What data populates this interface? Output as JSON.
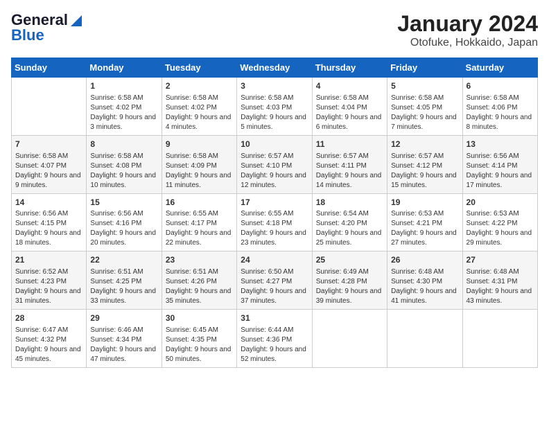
{
  "logo": {
    "line1": "General",
    "line2": "Blue"
  },
  "title": "January 2024",
  "subtitle": "Otofuke, Hokkaido, Japan",
  "days_of_week": [
    "Sunday",
    "Monday",
    "Tuesday",
    "Wednesday",
    "Thursday",
    "Friday",
    "Saturday"
  ],
  "weeks": [
    [
      {
        "day": "",
        "sunrise": "",
        "sunset": "",
        "daylight": ""
      },
      {
        "day": "1",
        "sunrise": "Sunrise: 6:58 AM",
        "sunset": "Sunset: 4:02 PM",
        "daylight": "Daylight: 9 hours and 3 minutes."
      },
      {
        "day": "2",
        "sunrise": "Sunrise: 6:58 AM",
        "sunset": "Sunset: 4:02 PM",
        "daylight": "Daylight: 9 hours and 4 minutes."
      },
      {
        "day": "3",
        "sunrise": "Sunrise: 6:58 AM",
        "sunset": "Sunset: 4:03 PM",
        "daylight": "Daylight: 9 hours and 5 minutes."
      },
      {
        "day": "4",
        "sunrise": "Sunrise: 6:58 AM",
        "sunset": "Sunset: 4:04 PM",
        "daylight": "Daylight: 9 hours and 6 minutes."
      },
      {
        "day": "5",
        "sunrise": "Sunrise: 6:58 AM",
        "sunset": "Sunset: 4:05 PM",
        "daylight": "Daylight: 9 hours and 7 minutes."
      },
      {
        "day": "6",
        "sunrise": "Sunrise: 6:58 AM",
        "sunset": "Sunset: 4:06 PM",
        "daylight": "Daylight: 9 hours and 8 minutes."
      }
    ],
    [
      {
        "day": "7",
        "sunrise": "Sunrise: 6:58 AM",
        "sunset": "Sunset: 4:07 PM",
        "daylight": "Daylight: 9 hours and 9 minutes."
      },
      {
        "day": "8",
        "sunrise": "Sunrise: 6:58 AM",
        "sunset": "Sunset: 4:08 PM",
        "daylight": "Daylight: 9 hours and 10 minutes."
      },
      {
        "day": "9",
        "sunrise": "Sunrise: 6:58 AM",
        "sunset": "Sunset: 4:09 PM",
        "daylight": "Daylight: 9 hours and 11 minutes."
      },
      {
        "day": "10",
        "sunrise": "Sunrise: 6:57 AM",
        "sunset": "Sunset: 4:10 PM",
        "daylight": "Daylight: 9 hours and 12 minutes."
      },
      {
        "day": "11",
        "sunrise": "Sunrise: 6:57 AM",
        "sunset": "Sunset: 4:11 PM",
        "daylight": "Daylight: 9 hours and 14 minutes."
      },
      {
        "day": "12",
        "sunrise": "Sunrise: 6:57 AM",
        "sunset": "Sunset: 4:12 PM",
        "daylight": "Daylight: 9 hours and 15 minutes."
      },
      {
        "day": "13",
        "sunrise": "Sunrise: 6:56 AM",
        "sunset": "Sunset: 4:14 PM",
        "daylight": "Daylight: 9 hours and 17 minutes."
      }
    ],
    [
      {
        "day": "14",
        "sunrise": "Sunrise: 6:56 AM",
        "sunset": "Sunset: 4:15 PM",
        "daylight": "Daylight: 9 hours and 18 minutes."
      },
      {
        "day": "15",
        "sunrise": "Sunrise: 6:56 AM",
        "sunset": "Sunset: 4:16 PM",
        "daylight": "Daylight: 9 hours and 20 minutes."
      },
      {
        "day": "16",
        "sunrise": "Sunrise: 6:55 AM",
        "sunset": "Sunset: 4:17 PM",
        "daylight": "Daylight: 9 hours and 22 minutes."
      },
      {
        "day": "17",
        "sunrise": "Sunrise: 6:55 AM",
        "sunset": "Sunset: 4:18 PM",
        "daylight": "Daylight: 9 hours and 23 minutes."
      },
      {
        "day": "18",
        "sunrise": "Sunrise: 6:54 AM",
        "sunset": "Sunset: 4:20 PM",
        "daylight": "Daylight: 9 hours and 25 minutes."
      },
      {
        "day": "19",
        "sunrise": "Sunrise: 6:53 AM",
        "sunset": "Sunset: 4:21 PM",
        "daylight": "Daylight: 9 hours and 27 minutes."
      },
      {
        "day": "20",
        "sunrise": "Sunrise: 6:53 AM",
        "sunset": "Sunset: 4:22 PM",
        "daylight": "Daylight: 9 hours and 29 minutes."
      }
    ],
    [
      {
        "day": "21",
        "sunrise": "Sunrise: 6:52 AM",
        "sunset": "Sunset: 4:23 PM",
        "daylight": "Daylight: 9 hours and 31 minutes."
      },
      {
        "day": "22",
        "sunrise": "Sunrise: 6:51 AM",
        "sunset": "Sunset: 4:25 PM",
        "daylight": "Daylight: 9 hours and 33 minutes."
      },
      {
        "day": "23",
        "sunrise": "Sunrise: 6:51 AM",
        "sunset": "Sunset: 4:26 PM",
        "daylight": "Daylight: 9 hours and 35 minutes."
      },
      {
        "day": "24",
        "sunrise": "Sunrise: 6:50 AM",
        "sunset": "Sunset: 4:27 PM",
        "daylight": "Daylight: 9 hours and 37 minutes."
      },
      {
        "day": "25",
        "sunrise": "Sunrise: 6:49 AM",
        "sunset": "Sunset: 4:28 PM",
        "daylight": "Daylight: 9 hours and 39 minutes."
      },
      {
        "day": "26",
        "sunrise": "Sunrise: 6:48 AM",
        "sunset": "Sunset: 4:30 PM",
        "daylight": "Daylight: 9 hours and 41 minutes."
      },
      {
        "day": "27",
        "sunrise": "Sunrise: 6:48 AM",
        "sunset": "Sunset: 4:31 PM",
        "daylight": "Daylight: 9 hours and 43 minutes."
      }
    ],
    [
      {
        "day": "28",
        "sunrise": "Sunrise: 6:47 AM",
        "sunset": "Sunset: 4:32 PM",
        "daylight": "Daylight: 9 hours and 45 minutes."
      },
      {
        "day": "29",
        "sunrise": "Sunrise: 6:46 AM",
        "sunset": "Sunset: 4:34 PM",
        "daylight": "Daylight: 9 hours and 47 minutes."
      },
      {
        "day": "30",
        "sunrise": "Sunrise: 6:45 AM",
        "sunset": "Sunset: 4:35 PM",
        "daylight": "Daylight: 9 hours and 50 minutes."
      },
      {
        "day": "31",
        "sunrise": "Sunrise: 6:44 AM",
        "sunset": "Sunset: 4:36 PM",
        "daylight": "Daylight: 9 hours and 52 minutes."
      },
      {
        "day": "",
        "sunrise": "",
        "sunset": "",
        "daylight": ""
      },
      {
        "day": "",
        "sunrise": "",
        "sunset": "",
        "daylight": ""
      },
      {
        "day": "",
        "sunrise": "",
        "sunset": "",
        "daylight": ""
      }
    ]
  ]
}
